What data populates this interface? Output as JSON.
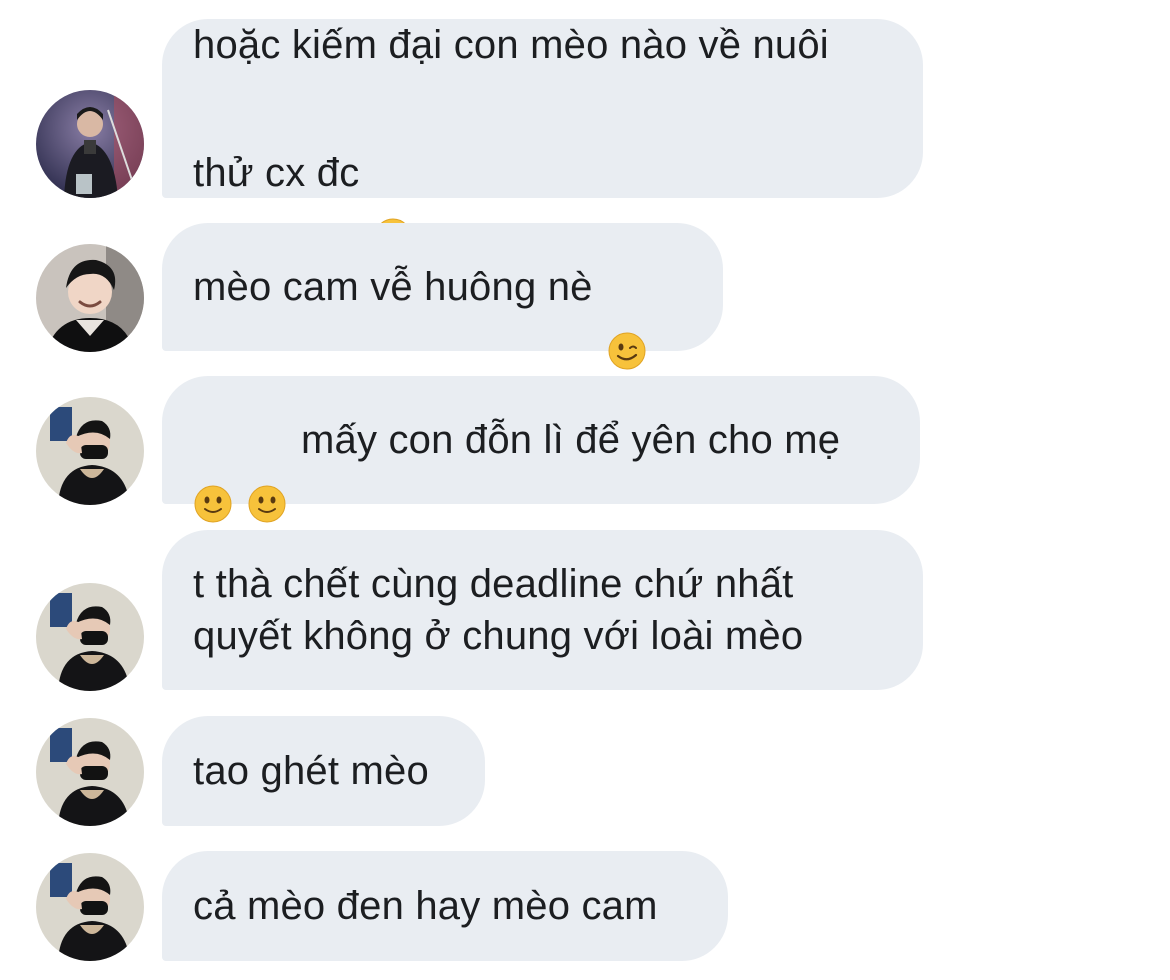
{
  "messages": [
    {
      "line1": "hoặc kiếm đại con mèo nào về nuôi",
      "line2": "thử cx đc",
      "emoji": "face-with-hand-over-mouth"
    },
    {
      "text": "mèo cam vễ huông nè",
      "emoji": "winking-face"
    },
    {
      "text": "mấy con đỗn lì để yên cho mẹ",
      "emoji_before": [
        "slightly-smiling-face",
        "slightly-smiling-face"
      ]
    },
    {
      "text": "t thà chết cùng deadline chứ nhất\nquyết không ở chung với loài mèo"
    },
    {
      "text": "tao ghét mèo"
    },
    {
      "text": "cả mèo đen hay mèo cam"
    }
  ],
  "colors": {
    "bubble": "#e9edf2",
    "text": "#1c1e21",
    "background": "#ffffff"
  }
}
